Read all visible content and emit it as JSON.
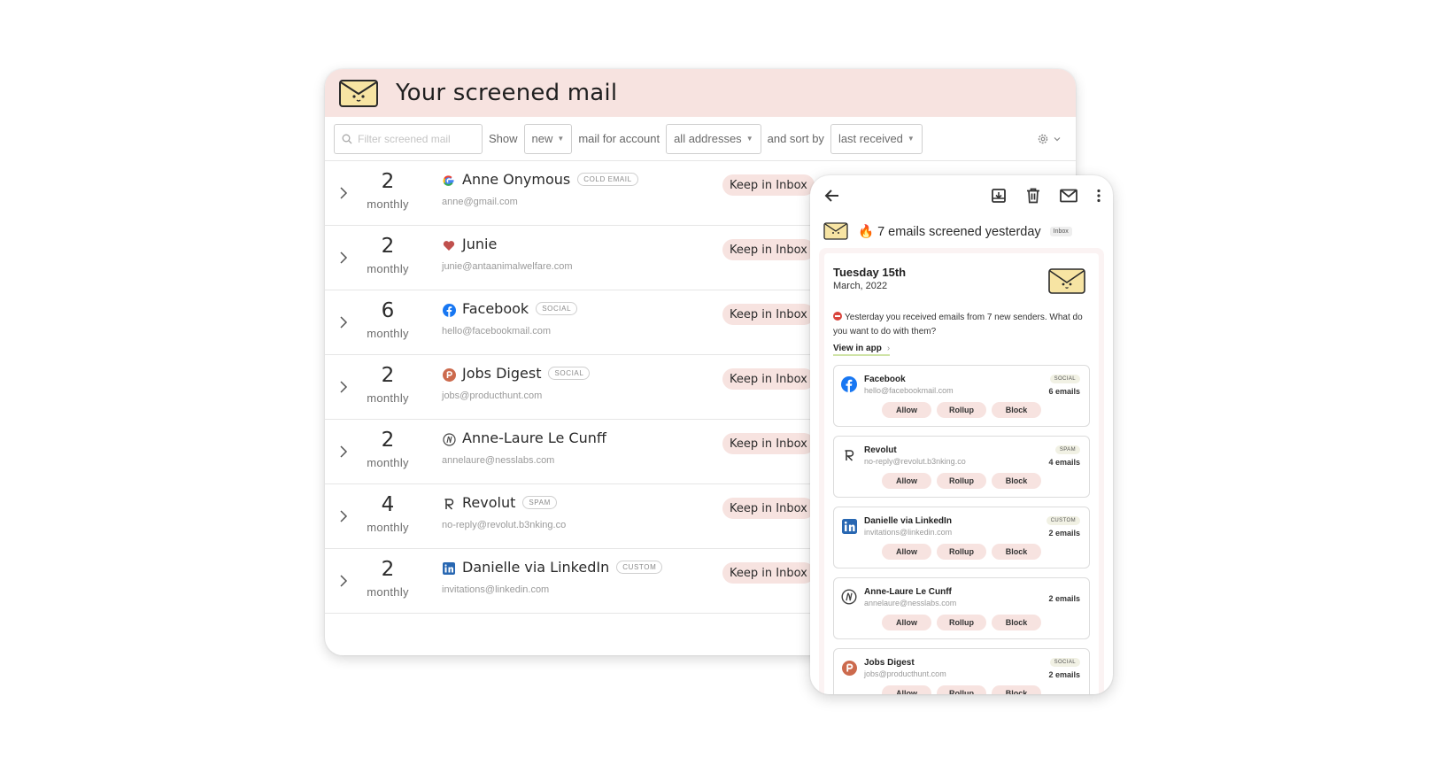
{
  "main": {
    "title": "Your screened mail",
    "search_placeholder": "Filter screened mail",
    "toolbar": {
      "show_label": "Show",
      "show_value": "new",
      "account_label": "mail for account",
      "account_value": "all addresses",
      "sort_label": "and sort by",
      "sort_value": "last received"
    },
    "rows": [
      {
        "count": "2",
        "freq": "monthly",
        "icon": "google-icon",
        "name": "Anne Onymous",
        "tag": "COLD EMAIL",
        "email": "anne@gmail.com",
        "action": "Keep in Inbox"
      },
      {
        "count": "2",
        "freq": "monthly",
        "icon": "heart-icon",
        "name": "Junie",
        "tag": "",
        "email": "junie@antaanimalwelfare.com",
        "action": "Keep in Inbox"
      },
      {
        "count": "6",
        "freq": "monthly",
        "icon": "facebook-icon",
        "name": "Facebook",
        "tag": "SOCIAL",
        "email": "hello@facebookmail.com",
        "action": "Keep in Inbox"
      },
      {
        "count": "2",
        "freq": "monthly",
        "icon": "producthunt-icon",
        "name": "Jobs Digest",
        "tag": "SOCIAL",
        "email": "jobs@producthunt.com",
        "action": "Keep in Inbox"
      },
      {
        "count": "2",
        "freq": "monthly",
        "icon": "nesslabs-icon",
        "name": "Anne-Laure Le Cunff",
        "tag": "",
        "email": "annelaure@nesslabs.com",
        "action": "Keep in Inbox"
      },
      {
        "count": "4",
        "freq": "monthly",
        "icon": "revolut-icon",
        "name": "Revolut",
        "tag": "SPAM",
        "email": "no-reply@revolut.b3nking.co",
        "action": "Keep in Inbox"
      },
      {
        "count": "2",
        "freq": "monthly",
        "icon": "linkedin-icon",
        "name": "Danielle via LinkedIn",
        "tag": "CUSTOM",
        "email": "invitations@linkedin.com",
        "action": "Keep in Inbox"
      }
    ]
  },
  "phone": {
    "subject": "🔥 7 emails screened yesterday",
    "inbox_label": "Inbox",
    "date_title": "Tuesday 15th",
    "date_sub": "March, 2022",
    "intro": "Yesterday you received emails from 7 new senders. What do you want to do with them?",
    "view_link": "View in app",
    "buttons": {
      "allow": "Allow",
      "rollup": "Rollup",
      "block": "Block"
    },
    "senders": [
      {
        "icon": "facebook-icon",
        "name": "Facebook",
        "email": "hello@facebookmail.com",
        "tag": "SOCIAL",
        "count": "6 emails"
      },
      {
        "icon": "revolut-icon",
        "name": "Revolut",
        "email": "no-reply@revolut.b3nking.co",
        "tag": "SPAM",
        "count": "4 emails"
      },
      {
        "icon": "linkedin-icon",
        "name": "Danielle via LinkedIn",
        "email": "invitations@linkedin.com",
        "tag": "CUSTOM",
        "count": "2 emails"
      },
      {
        "icon": "nesslabs-icon",
        "name": "Anne-Laure Le Cunff",
        "email": "annelaure@nesslabs.com",
        "tag": "",
        "count": "2 emails"
      },
      {
        "icon": "producthunt-icon",
        "name": "Jobs Digest",
        "email": "jobs@producthunt.com",
        "tag": "SOCIAL",
        "count": "2 emails"
      }
    ]
  },
  "colors": {
    "header_pink": "#f7e3e0",
    "button_pink": "#f7e3e0",
    "envelope_yellow": "#f7e4a3"
  }
}
